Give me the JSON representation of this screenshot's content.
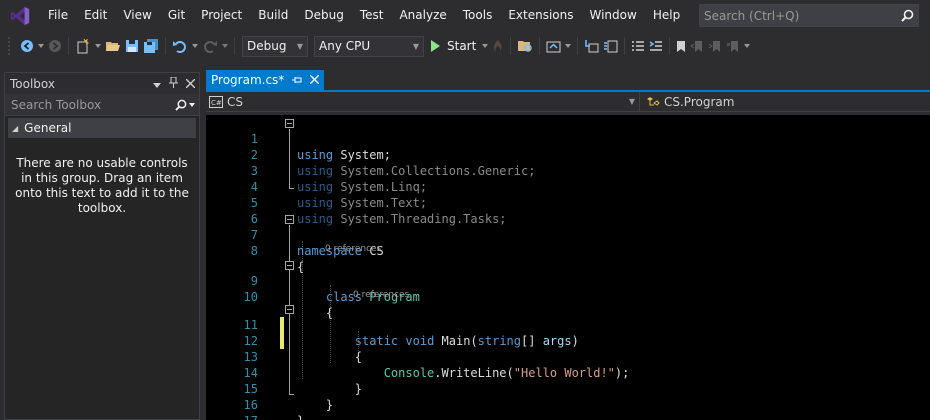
{
  "menu": {
    "items": [
      "File",
      "Edit",
      "View",
      "Git",
      "Project",
      "Build",
      "Debug",
      "Test",
      "Analyze",
      "Tools",
      "Extensions",
      "Window",
      "Help"
    ],
    "search_placeholder": "Search (Ctrl+Q)"
  },
  "toolbar": {
    "config": "Debug",
    "platform": "Any CPU",
    "start_label": "Start"
  },
  "toolbox": {
    "title": "Toolbox",
    "search_placeholder": "Search Toolbox",
    "group": "General",
    "empty_message": "There are no usable controls in this group. Drag an item onto this text to add it to the toolbox."
  },
  "editor": {
    "tab_title": "Program.cs*",
    "nav_left": "CS",
    "nav_right": "CS.Program",
    "line_numbers": [
      "1",
      "2",
      "3",
      "4",
      "5",
      "6",
      "7",
      "8",
      "9",
      "10",
      "11",
      "12",
      "13",
      "14",
      "15",
      "16",
      "17"
    ],
    "codelens_class": "0 references",
    "codelens_method": "0 references"
  },
  "colors": {
    "accent": "#007acc",
    "background": "#2d2d30",
    "editor_bg": "#000000",
    "keyword": "#569cd6",
    "type": "#4ec9b0",
    "string": "#d69d85",
    "line_number": "#2b91af"
  }
}
